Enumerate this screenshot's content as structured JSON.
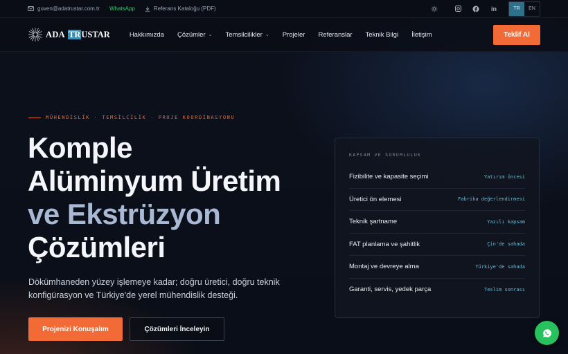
{
  "topbar": {
    "email": "guven@adatrustar.com.tr",
    "whatsapp": "WhatsApp",
    "catalog": "Referans Kataloğu (PDF)",
    "social_instagram_icon": "instagram-icon",
    "social_facebook_icon": "facebook-icon",
    "social_linkedin": "in",
    "lang": [
      "TR",
      "EN"
    ],
    "active_lang": "TR"
  },
  "nav": {
    "logo_part1": "ADA",
    "logo_part2_hl": "TR",
    "logo_part2_rest": "USTAR",
    "items": [
      {
        "label": "Hakkımızda",
        "dropdown": false
      },
      {
        "label": "Çözümler",
        "dropdown": true
      },
      {
        "label": "Temsilcilikler",
        "dropdown": true
      },
      {
        "label": "Projeler",
        "dropdown": false
      },
      {
        "label": "Referanslar",
        "dropdown": false
      },
      {
        "label": "Teknik Bilgi",
        "dropdown": false
      },
      {
        "label": "İletişim",
        "dropdown": false
      }
    ],
    "cta": "Teklif Al"
  },
  "hero": {
    "eyebrow": "MÜHENDİSLİK · TEMSİLCİLİK · PROJE KOORDİNASYONU",
    "headline": [
      "Komple",
      "Alüminyum Üretim",
      "ve Ekstrüzyon",
      "Çözümleri"
    ],
    "subtitle": "Dökümhaneden yüzey işlemeye kadar; doğru üretici, doğru teknik konfigürasyon ve Türkiye'de yerel mühendislik desteği.",
    "primary_button": "Projenizi Konuşalım",
    "secondary_button": "Çözümleri İnceleyin"
  },
  "scope_card": {
    "title": "KAPSAM VE SORUMLULUK",
    "rows": [
      {
        "label": "Fizibilite ve kapasite seçimi",
        "value": "Yatırım öncesi"
      },
      {
        "label": "Üretici ön elemesi",
        "value": "Fabrika değerlendirmesi"
      },
      {
        "label": "Teknik şartname",
        "value": "Yazılı kapsam"
      },
      {
        "label": "FAT planlama ve şahitlik",
        "value": "Çin'de sahada"
      },
      {
        "label": "Montaj ve devreye alma",
        "value": "Türkiye'de sahada"
      },
      {
        "label": "Garanti, servis, yedek parça",
        "value": "Teslim sonrası"
      }
    ]
  },
  "colors": {
    "accent": "#f26a35",
    "teal": "#6fb7cf",
    "whatsapp": "#27c25e"
  }
}
